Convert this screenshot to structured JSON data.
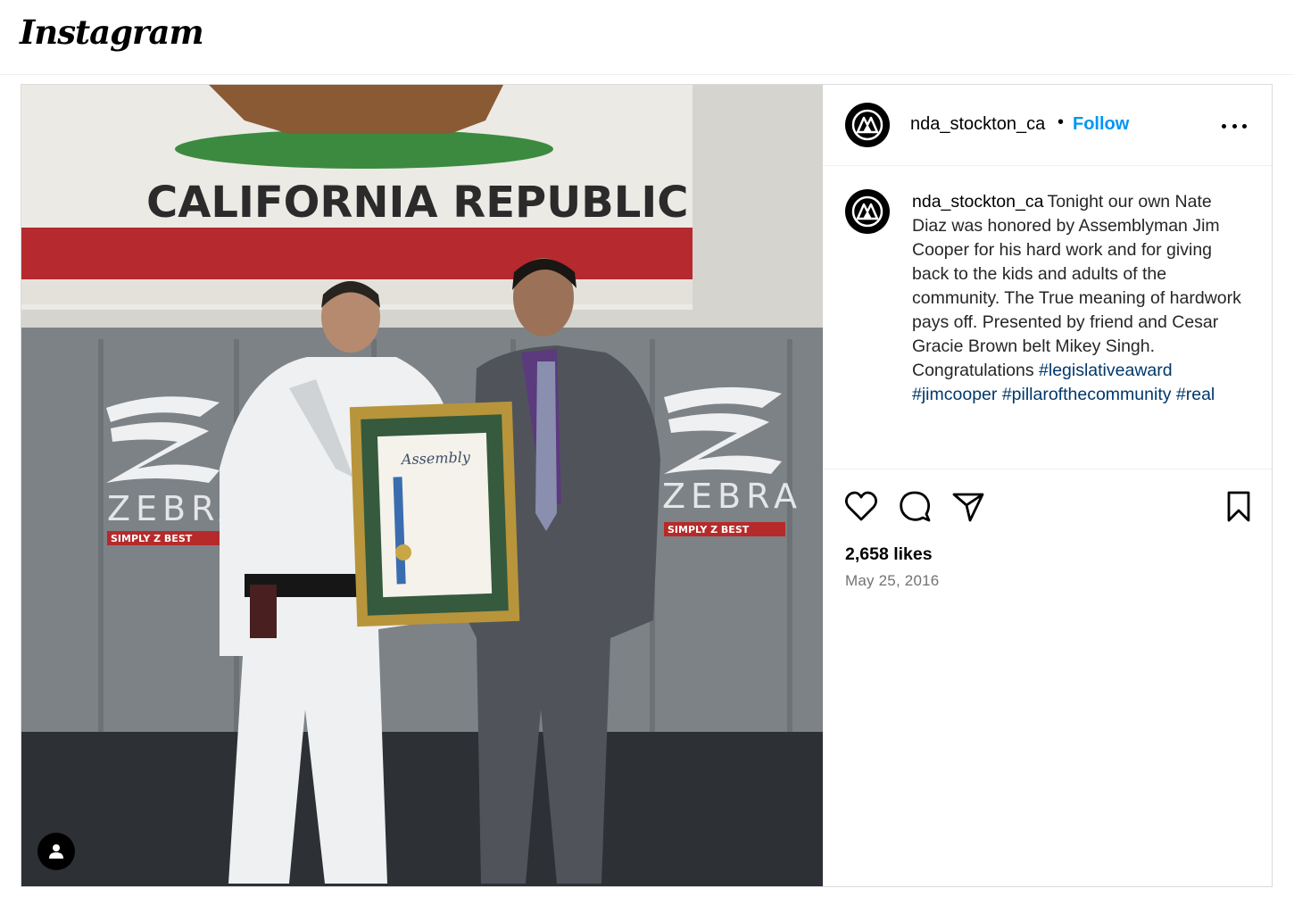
{
  "app": {
    "logo_text": "Instagram"
  },
  "post": {
    "username": "nda_stockton_ca",
    "separator": "•",
    "follow_label": "Follow",
    "caption": {
      "username": "nda_stockton_ca",
      "text": "Tonight our own Nate Diaz was honored by Assemblyman Jim Cooper for his hard work and for giving back to the kids and adults of the community. The True meaning of hardwork pays off. Presented by friend and Cesar Gracie Brown belt Mikey Singh. Congratulations",
      "hashtags": [
        "#legislativeaward",
        "#jimcooper",
        "#pillarofthecommunity",
        "#real"
      ]
    },
    "likes": "2,658 likes",
    "date": "May 25, 2016",
    "photo_text": {
      "flag": "CALIFORNIA REPUBLIC",
      "brand_left": "ZEBRA",
      "brand_right": "ZEBRA",
      "slogan_left": "SIMPLY Z BEST",
      "slogan_right": "SIMPLY Z BEST",
      "certificate": "Assembly"
    },
    "icons": {
      "avatar": "nda-logo-icon",
      "more": "more-options-icon",
      "like": "heart-icon",
      "comment": "comment-icon",
      "share": "share-icon",
      "save": "bookmark-icon",
      "user_tag": "user-tag-icon"
    },
    "colors": {
      "accent": "#0095f6",
      "hashtag": "#00376b",
      "muted": "#737373"
    }
  }
}
